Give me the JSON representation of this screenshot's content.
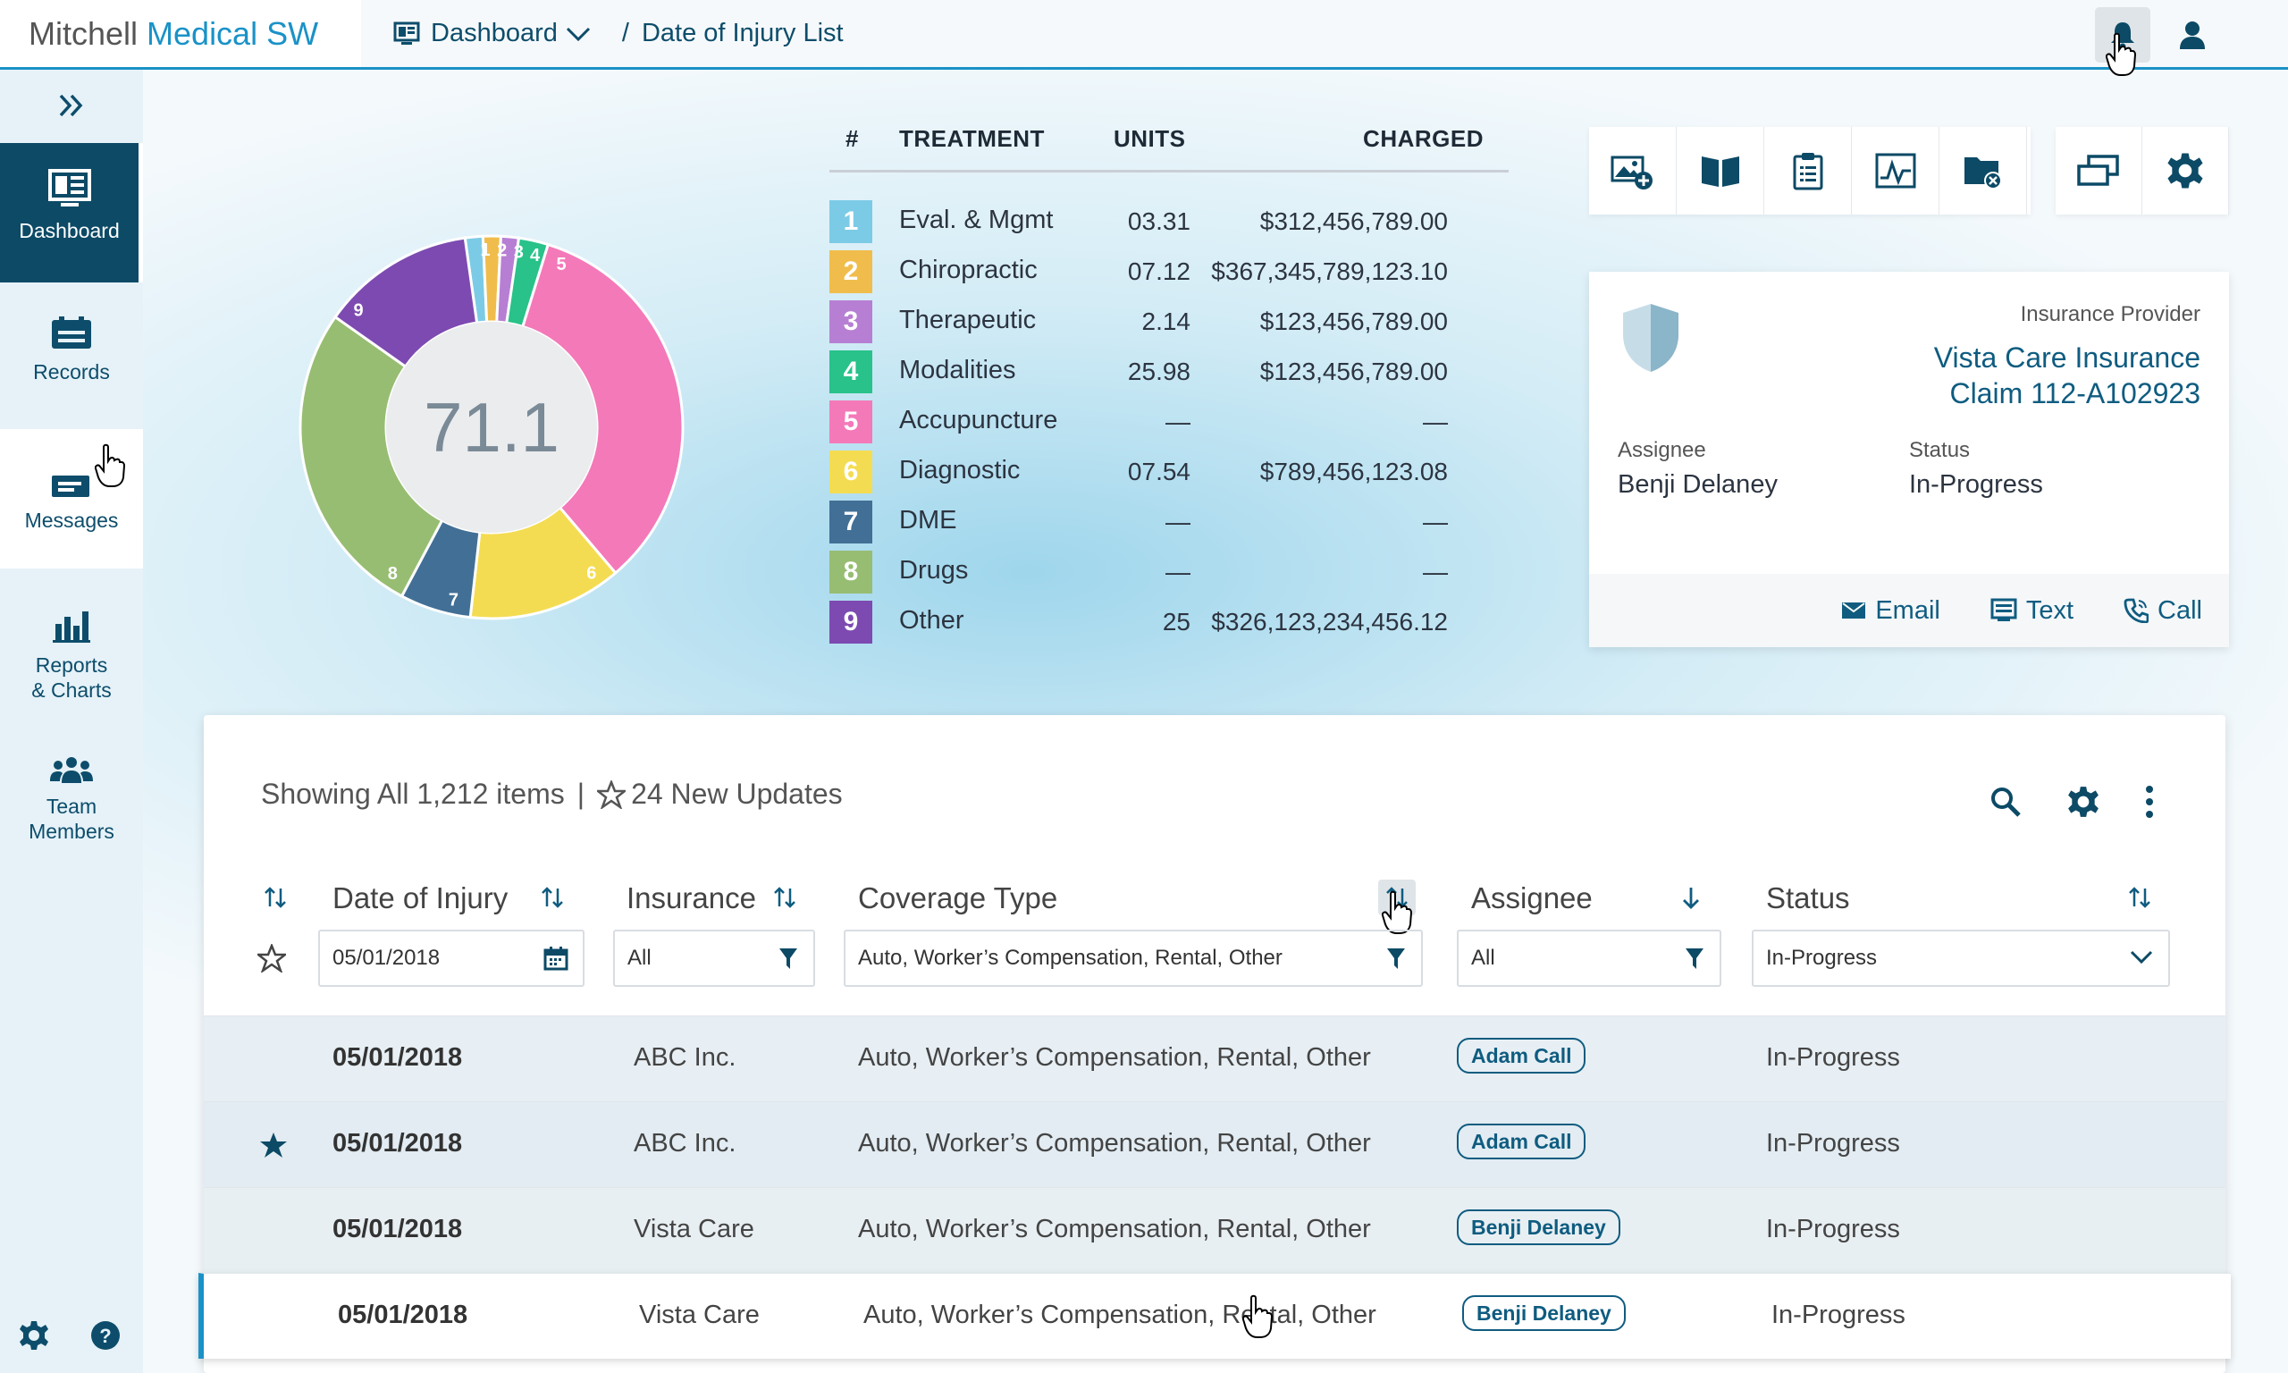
{
  "brand": {
    "name_part1": "Mitchell ",
    "name_part2": "Medical SW"
  },
  "breadcrumb": {
    "root": "Dashboard",
    "separator": "/",
    "current": "Date of Injury List"
  },
  "sidebar": {
    "items": [
      {
        "label": "Dashboard",
        "icon": "dashboard-icon",
        "active": true
      },
      {
        "label": "Records",
        "icon": "records-icon"
      },
      {
        "label": "Messages",
        "icon": "messages-icon"
      },
      {
        "label_line1": "Reports",
        "label_line2": "& Charts",
        "icon": "bar-chart-icon"
      },
      {
        "label_line1": "Team",
        "label_line2": "Members",
        "icon": "team-icon"
      }
    ]
  },
  "chart_data": {
    "type": "pie",
    "center_value": "71.1",
    "slice_labels": [
      "1",
      "2",
      "3",
      "4",
      "5",
      "6",
      "7",
      "8",
      "9"
    ],
    "values": [
      1.5,
      1.5,
      1.5,
      2.5,
      34,
      13,
      6,
      27,
      13
    ],
    "colors": [
      "#7ccbe6",
      "#f0bd4c",
      "#b77fd3",
      "#28c28a",
      "#f479b9",
      "#f4dc52",
      "#426f96",
      "#97bd72",
      "#7d4ab1"
    ]
  },
  "treatments": {
    "headers": {
      "num": "#",
      "treatment": "TREATMENT",
      "units": "UNITS",
      "charged": "CHARGED"
    },
    "rows": [
      {
        "num": "1",
        "name": "Eval. & Mgmt",
        "units": "03.31",
        "charged": "$312,456,789.00",
        "color": "#7ccbe6"
      },
      {
        "num": "2",
        "name": "Chiropractic",
        "units": "07.12",
        "charged": "$367,345,789,123.10",
        "color": "#f0bd4c"
      },
      {
        "num": "3",
        "name": "Therapeutic",
        "units": "2.14",
        "charged": "$123,456,789.00",
        "color": "#b77fd3"
      },
      {
        "num": "4",
        "name": "Modalities",
        "units": "25.98",
        "charged": "$123,456,789.00",
        "color": "#28c28a"
      },
      {
        "num": "5",
        "name": "Accupuncture",
        "units": "—",
        "charged": "—",
        "color": "#f479b9"
      },
      {
        "num": "6",
        "name": "Diagnostic",
        "units": "07.54",
        "charged": "$789,456,123.08",
        "color": "#f4dc52"
      },
      {
        "num": "7",
        "name": "DME",
        "units": "—",
        "charged": "—",
        "color": "#426f96"
      },
      {
        "num": "8",
        "name": "Drugs",
        "units": "—",
        "charged": "—",
        "color": "#97bd72"
      },
      {
        "num": "9",
        "name": "Other",
        "units": "25",
        "charged": "$326,123,234,456.12",
        "color": "#7d4ab1"
      }
    ]
  },
  "info_card": {
    "provider_label": "Insurance Provider",
    "provider_name": "Vista Care Insurance",
    "claim": "Claim 112-A102923",
    "assignee_label": "Assignee",
    "assignee": "Benji Delaney",
    "status_label": "Status",
    "status": "In-Progress",
    "actions": {
      "email": "Email",
      "text": "Text",
      "call": "Call"
    }
  },
  "grid": {
    "summary": "Showing All 1,212 items",
    "separator": "|",
    "updates": "24 New Updates",
    "columns": {
      "date": "Date of Injury",
      "insurance": "Insurance",
      "coverage": "Coverage Type",
      "assignee": "Assignee",
      "status": "Status"
    },
    "filters": {
      "date": "05/01/2018",
      "insurance": "All",
      "coverage": "Auto, Worker’s Compensation, Rental, Other",
      "assignee": "All",
      "status": "In-Progress"
    },
    "rows": [
      {
        "starred": false,
        "date": "05/01/2018",
        "insurance": "ABC Inc.",
        "coverage": "Auto, Worker’s Compensation, Rental, Other",
        "assignee": "Adam Call",
        "status": "In-Progress"
      },
      {
        "starred": true,
        "date": "05/01/2018",
        "insurance": "ABC Inc.",
        "coverage": "Auto, Worker’s Compensation, Rental, Other",
        "assignee": "Adam Call",
        "status": "In-Progress"
      },
      {
        "starred": false,
        "date": "05/01/2018",
        "insurance": "Vista Care",
        "coverage": "Auto, Worker’s Compensation, Rental, Other",
        "assignee": "Benji Delaney",
        "status": "In-Progress"
      },
      {
        "starred": false,
        "date": "05/01/2018",
        "insurance": "Vista Care",
        "coverage": "Auto, Worker’s Compensation, Rental, Other",
        "assignee": "Benji Delaney",
        "status": "In-Progress",
        "selected": true
      }
    ]
  },
  "colors": {
    "accent": "#1a92c7",
    "nav_dark": "#0c4a66",
    "text_link": "#0f5c80"
  }
}
